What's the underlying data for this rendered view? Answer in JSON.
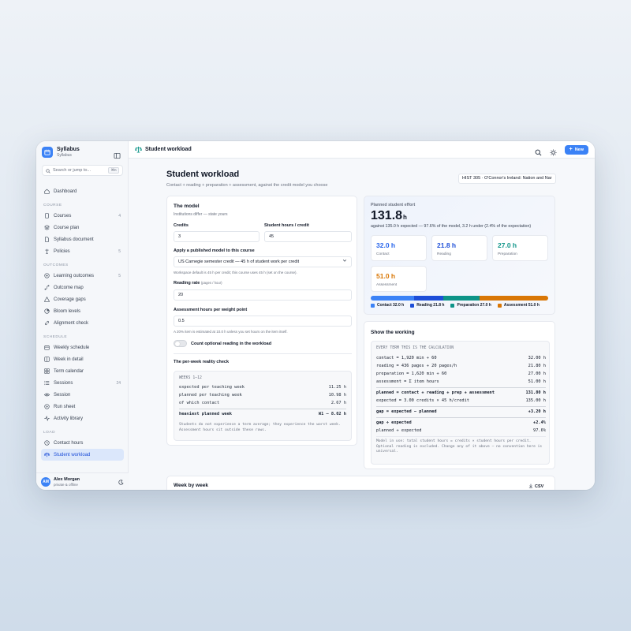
{
  "sidebar": {
    "brand_name": "Syllabus",
    "brand_sub": "Syllabus",
    "search_placeholder": "Search or jump to...",
    "search_kbd": "⌘K",
    "dashboard": "Dashboard",
    "sections": {
      "course": "COURSE",
      "outcomes": "OUTCOMES",
      "schedule": "SCHEDULE",
      "load": "LOAD"
    },
    "course_items": [
      {
        "label": "Courses",
        "count": "4"
      },
      {
        "label": "Course plan",
        "count": ""
      },
      {
        "label": "Syllabus document",
        "count": ""
      },
      {
        "label": "Policies",
        "count": "5"
      }
    ],
    "outcome_items": [
      {
        "label": "Learning outcomes",
        "count": "5"
      },
      {
        "label": "Outcome map",
        "count": ""
      },
      {
        "label": "Coverage gaps",
        "count": ""
      },
      {
        "label": "Bloom levels",
        "count": ""
      },
      {
        "label": "Alignment check",
        "count": ""
      }
    ],
    "schedule_items": [
      {
        "label": "Weekly schedule",
        "count": ""
      },
      {
        "label": "Week in detail",
        "count": ""
      },
      {
        "label": "Term calendar",
        "count": ""
      },
      {
        "label": "Sessions",
        "count": "24"
      },
      {
        "label": "Session",
        "count": ""
      },
      {
        "label": "Run sheet",
        "count": ""
      },
      {
        "label": "Activity library",
        "count": ""
      }
    ],
    "load_items": [
      {
        "label": "Contact hours",
        "count": ""
      },
      {
        "label": "Student workload",
        "count": ""
      }
    ],
    "user": {
      "initials": "AM",
      "name": "Alex Morgan",
      "status": "private & offline"
    }
  },
  "topbar": {
    "title": "Student workload",
    "new_label": "New"
  },
  "page": {
    "title": "Student workload",
    "subtitle": "Contact + reading + preparation + assessment, against the credit model you choose",
    "course": "HIST 305 · O'Connor's Ireland: Nation and Nar"
  },
  "model": {
    "title": "The model",
    "subtitle": "Institutions differ — state yours",
    "credits_label": "Credits",
    "credits_value": "3",
    "hours_label": "Student hours / credit",
    "hours_value": "45",
    "published_label": "Apply a published model to this course",
    "published_value": "US Carnegie semester credit — 45 h of student work per credit",
    "published_hint": "Workspace default is 45 h per credit; this course uses 45 h (set on the course).",
    "reading_label": "Reading rate",
    "reading_unit": "(pages / hour)",
    "reading_value": "20",
    "assess_label": "Assessment hours per weight point",
    "assess_value": "0.5",
    "assess_hint": "A 20% item is estimated at 10.0 h unless you set hours on the item itself.",
    "toggle_label": "Count optional reading in the workload",
    "reality_title": "The per-week reality check",
    "weeks_head": "WEEKS 1–12",
    "rows": [
      {
        "label": "expected per teaching week",
        "value": "11.25 h"
      },
      {
        "label": "planned per teaching week",
        "value": "10.98 h"
      },
      {
        "label": "of which contact",
        "value": "2.67 h"
      }
    ],
    "heaviest_label": "heaviest planned week",
    "heaviest_value": "W1 — 8.02 h",
    "note": "Students do not experience a term average; they experience the worst week. Assessment hours sit outside these rows."
  },
  "effort": {
    "label": "Planned student effort",
    "value": "131.8",
    "unit": "h",
    "sub": "against 135.0 h expected — 97.6% of the model, 3.2 h under (2.4% of the expectation)",
    "stats": [
      {
        "value": "32.0 h",
        "label": "Contact",
        "color": "#2563eb"
      },
      {
        "value": "21.8 h",
        "label": "Reading",
        "color": "#1d4ed8"
      },
      {
        "value": "27.0 h",
        "label": "Preparation",
        "color": "#0d9488"
      },
      {
        "value": "51.0 h",
        "label": "Assessment",
        "color": "#d97706"
      }
    ],
    "segments": [
      {
        "name": "Contact",
        "value": 32.0,
        "color": "#3b82f6"
      },
      {
        "name": "Reading",
        "value": 21.8,
        "color": "#1d4ed8"
      },
      {
        "name": "Preparation",
        "value": 27.0,
        "color": "#0d9488"
      },
      {
        "name": "Assessment",
        "value": 51.0,
        "color": "#d97706"
      }
    ],
    "legend": [
      "Contact 32.0 h",
      "Reading 21.8 h",
      "Preparation 27.0 h",
      "Assessment 51.0 h"
    ]
  },
  "working": {
    "title": "Show the working",
    "head": "EVERY TERM THIS IS THE CALCULATION",
    "rows1": [
      {
        "label": "contact = 1,920 min ÷ 60",
        "value": "32.00 h"
      },
      {
        "label": "reading = 436 pages ÷ 20 pages/h",
        "value": "21.80 h"
      },
      {
        "label": "preparation = 1,620 min ÷ 60",
        "value": "27.00 h"
      },
      {
        "label": "assessment = Σ item hours",
        "value": "51.00 h"
      }
    ],
    "planned_label": "planned = contact + reading + prep + assessment",
    "planned_value": "131.80 h",
    "expected_label": "expected = 3.00 credits × 45 h/credit",
    "expected_value": "135.00 h",
    "gap_label": "gap = expected − planned",
    "gap_value": "+3.20 h",
    "gapr_label": "gap ÷ expected",
    "gapr_value": "+2.4%",
    "plr_label": "planned ÷ expected",
    "plr_value": "97.6%",
    "note": "Model in use: total student hours = credits × student hours per credit. Optional reading is excluded. Change any of it above — no convention here is universal."
  },
  "week": {
    "title": "Week by week",
    "csv": "CSV"
  }
}
